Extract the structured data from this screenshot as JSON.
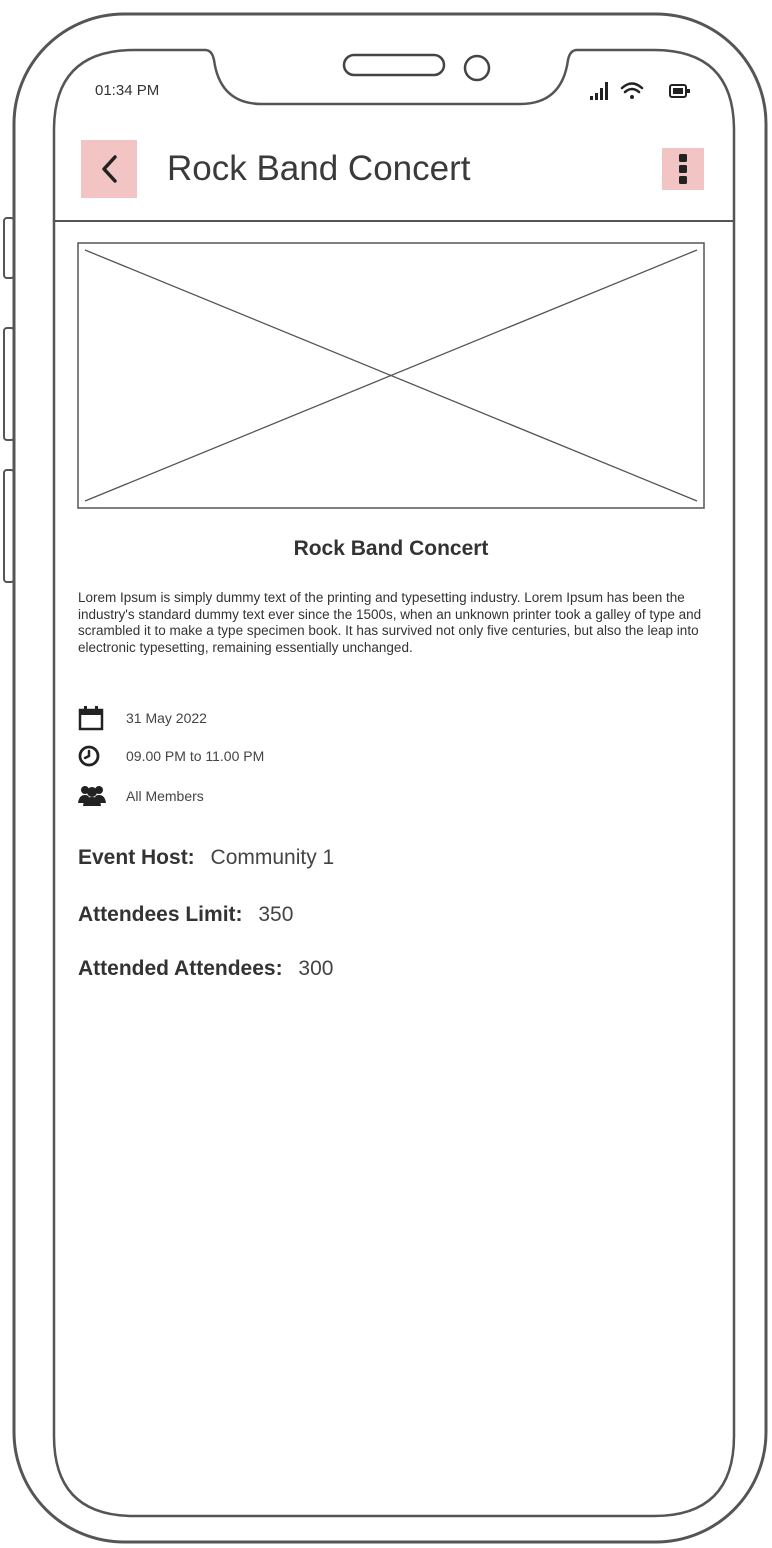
{
  "status_bar": {
    "time": "01:34 PM",
    "icons": [
      "signal-icon",
      "wifi-icon",
      "battery-icon"
    ]
  },
  "header": {
    "title": "Rock Band Concert",
    "back_icon": "chevron-left-icon",
    "menu_icon": "more-vertical-icon"
  },
  "event": {
    "image_icon": "image-placeholder-icon",
    "title": "Rock Band Concert",
    "description": "Lorem Ipsum is simply dummy text of the printing and typesetting industry. Lorem Ipsum has been the industry's standard dummy text ever since the 1500s, when an unknown printer took a galley of type and scrambled it to make a type specimen book. It has survived not only five centuries, but also the leap into electronic typesetting, remaining essentially unchanged.",
    "details": [
      {
        "icon": "calendar-icon",
        "text": "31 May 2022"
      },
      {
        "icon": "clock-icon",
        "text": "09.00 PM to 11.00 PM"
      },
      {
        "icon": "users-icon",
        "text": "All Members"
      }
    ],
    "host": {
      "label": "Event Host:",
      "value": "Community 1"
    },
    "limit": {
      "label": "Attendees Limit:",
      "value": "350"
    },
    "attended": {
      "label": "Attended Attendees:",
      "value": "300"
    }
  },
  "colors": {
    "accent": "#f2c4c4",
    "outline": "#555555",
    "text": "#333333"
  }
}
